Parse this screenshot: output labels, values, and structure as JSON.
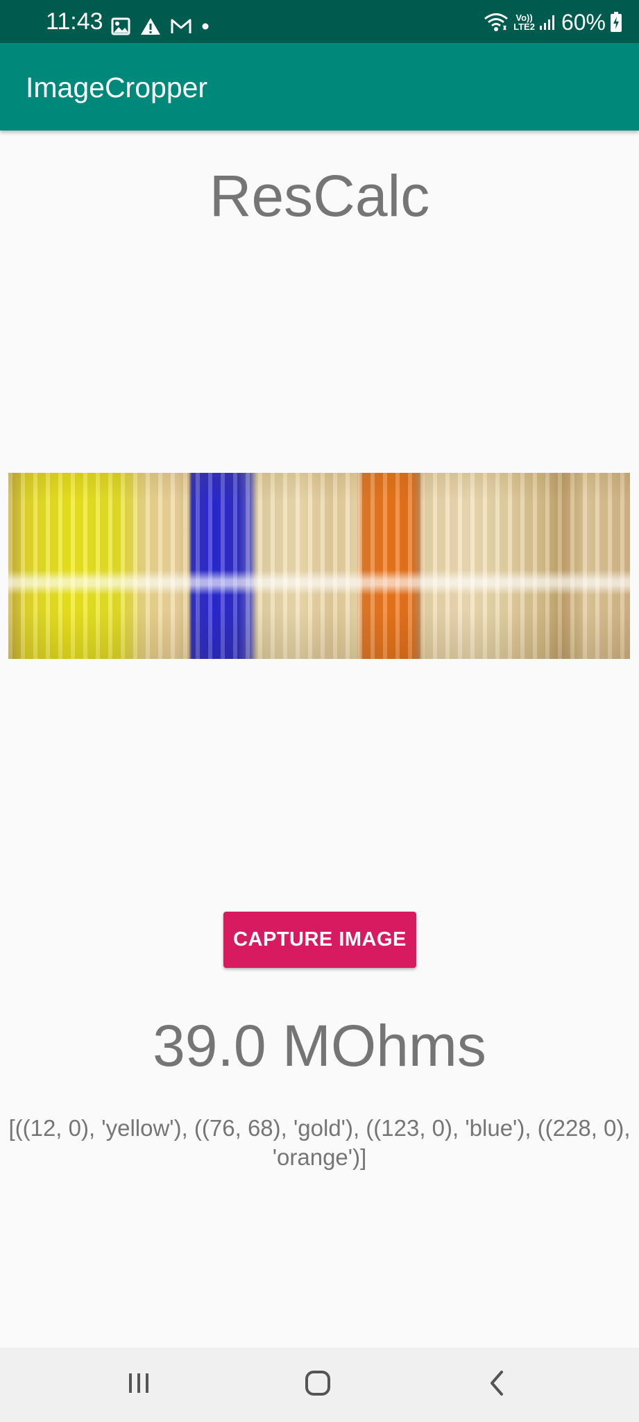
{
  "status_bar": {
    "time": "11:43",
    "left_icons": [
      "image-icon",
      "warning-icon",
      "gmail-icon",
      "dot-icon"
    ],
    "network_label_top": "Vo))",
    "network_label_bottom": "LTE2",
    "battery_text": "60%",
    "background": "#005b4f"
  },
  "app_bar": {
    "title": "ImageCropper",
    "background": "#00897b"
  },
  "main": {
    "heading": "ResCalc",
    "image_alt": "cropped resistor color bands",
    "capture_button_label": "CAPTURE IMAGE",
    "result_value": "39.0 MOhms",
    "detected_bands": "[((12, 0), 'yellow'), ((76, 68), 'gold'), ((123, 0), 'blue'), ((228, 0), 'orange')]",
    "button_color": "#d81b60",
    "text_color": "#757575"
  },
  "nav_bar": {
    "buttons": [
      "recent-apps-icon",
      "home-icon",
      "back-icon"
    ],
    "background": "#f0f0f0"
  }
}
